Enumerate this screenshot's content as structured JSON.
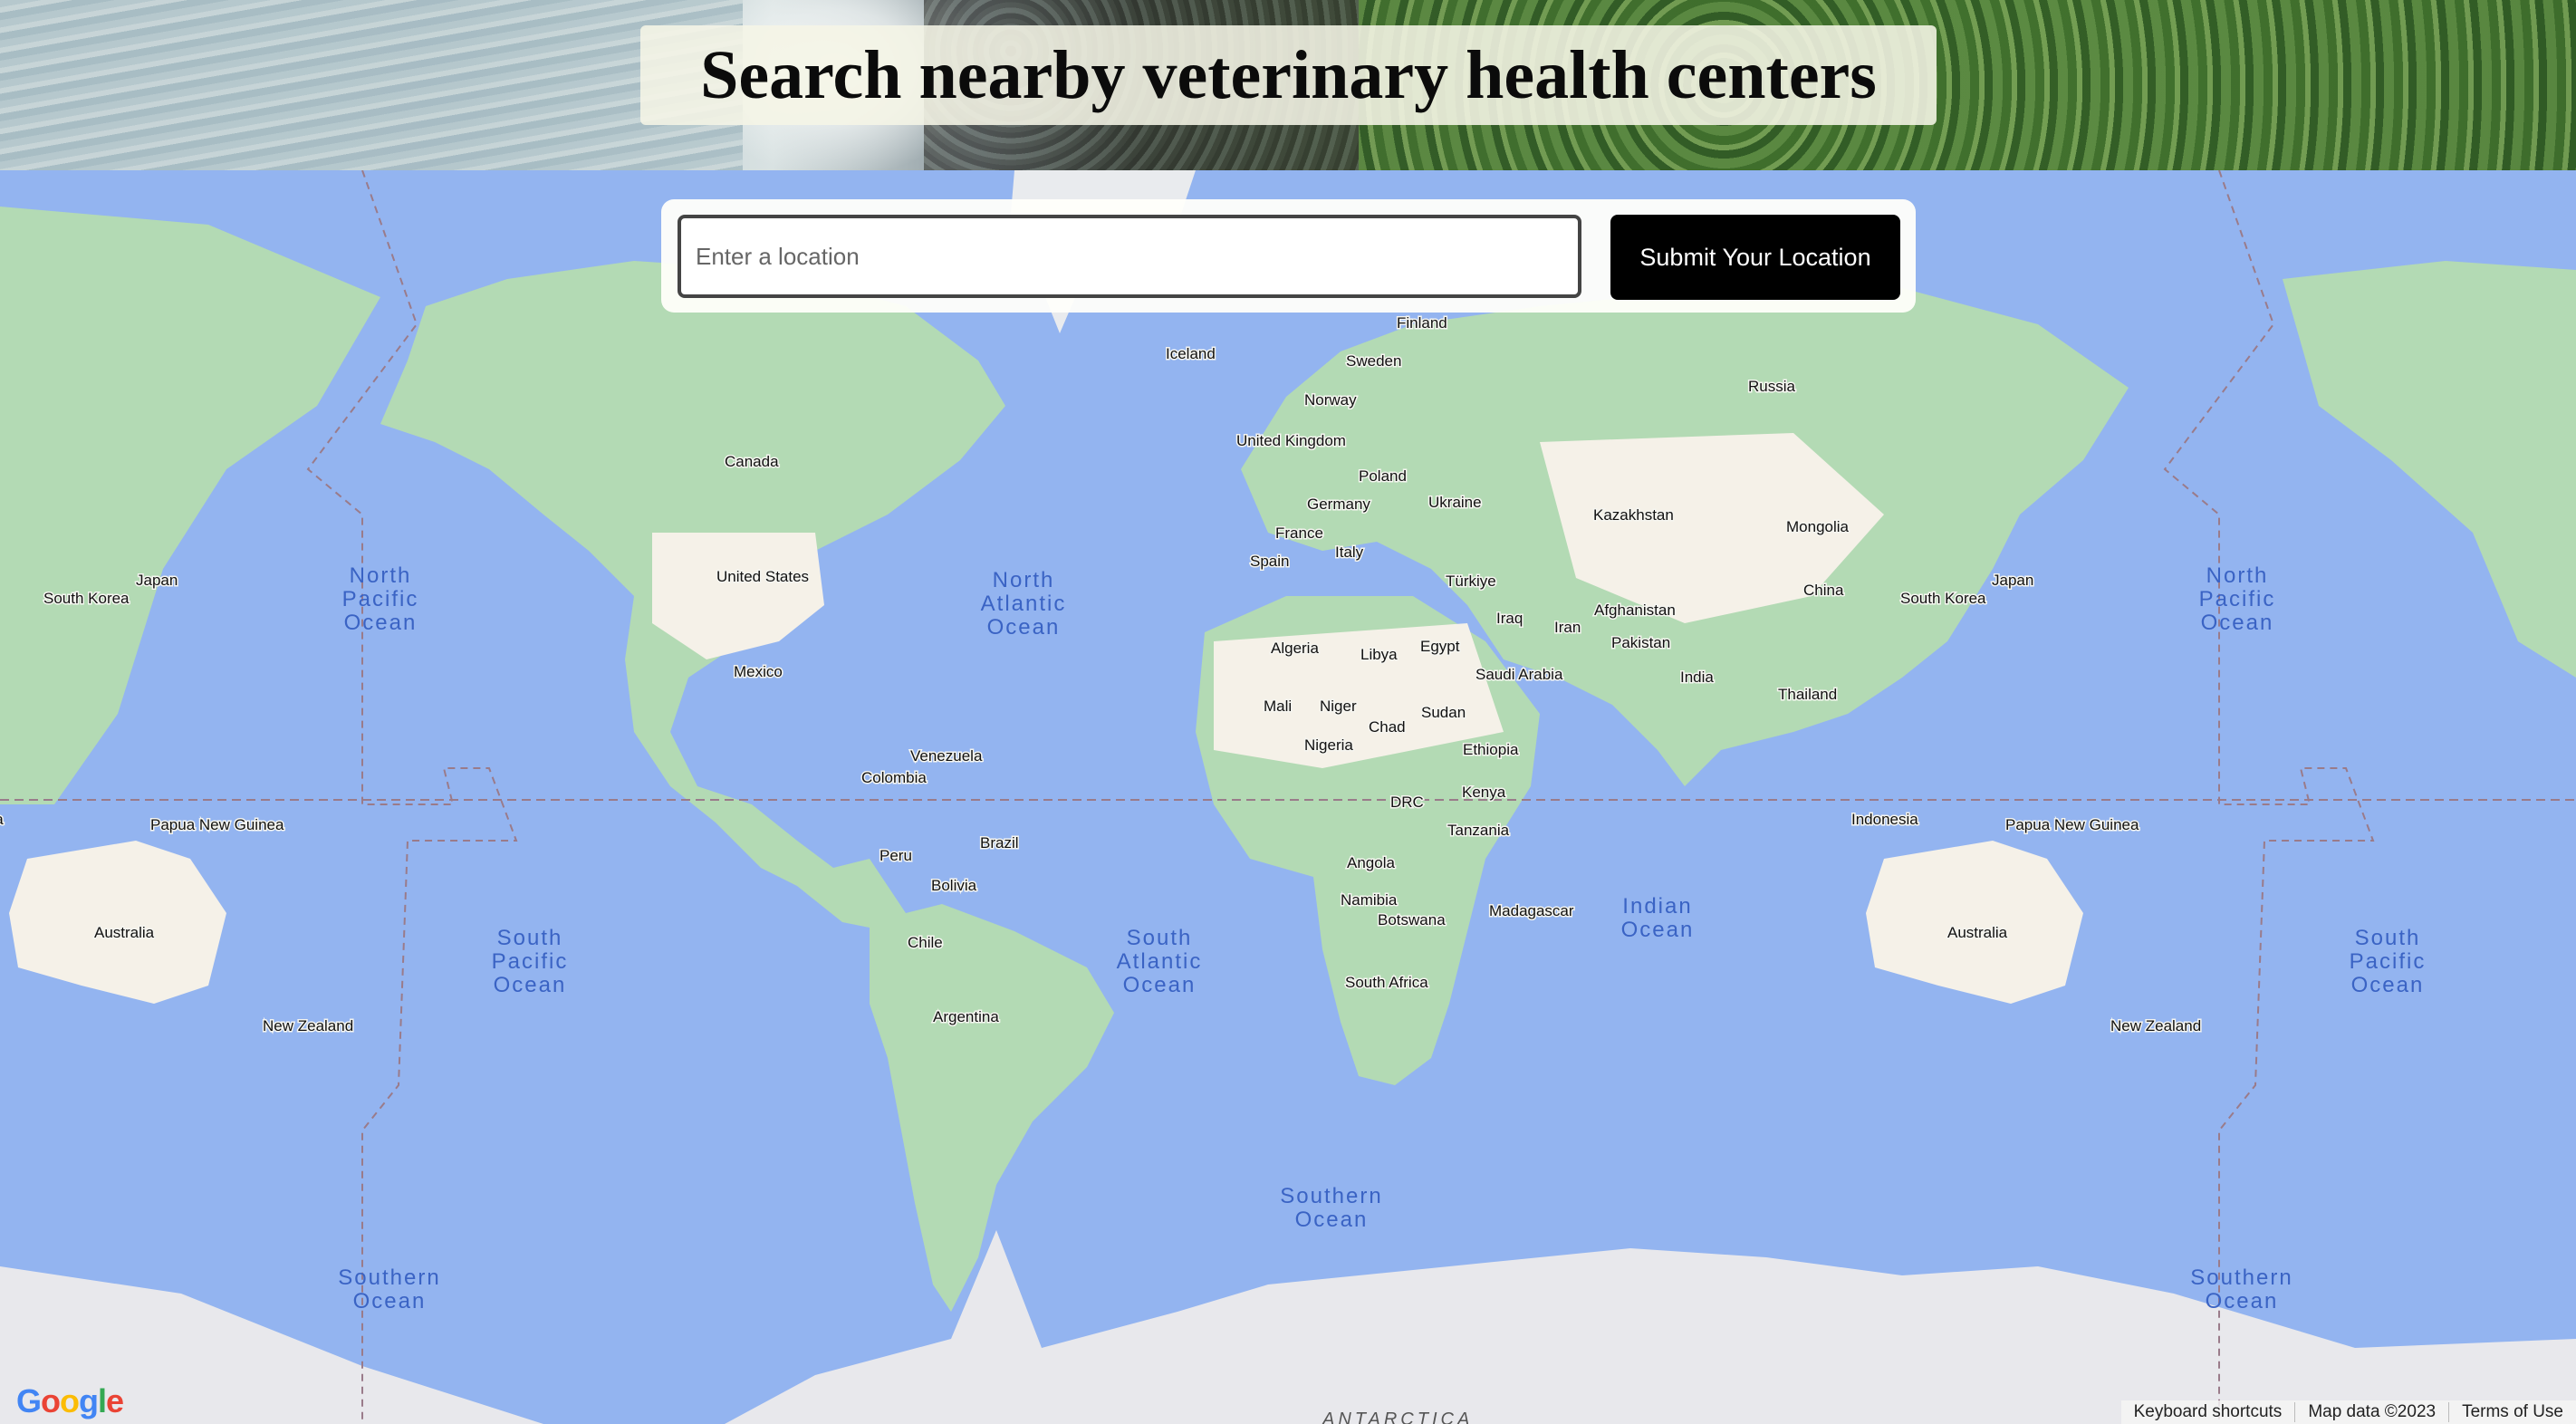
{
  "header": {
    "title": "Search nearby veterinary health centers"
  },
  "search": {
    "placeholder": "Enter a location",
    "value": "",
    "submit_label": "Submit Your Location"
  },
  "map": {
    "countries": [
      "Finland",
      "Iceland",
      "Sweden",
      "Norway",
      "Russia",
      "United Kingdom",
      "Poland",
      "Germany",
      "Ukraine",
      "France",
      "Kazakhstan",
      "Mongolia",
      "Italy",
      "Spain",
      "Türkiye",
      "Japan",
      "South Korea",
      "Canada",
      "United States",
      "Mexico",
      "Iraq",
      "Iran",
      "Afghanistan",
      "Pakistan",
      "China",
      "Algeria",
      "Libya",
      "Egypt",
      "Saudi Arabia",
      "India",
      "Thailand",
      "Mali",
      "Niger",
      "Chad",
      "Sudan",
      "Ethiopia",
      "Nigeria",
      "Venezuela",
      "Colombia",
      "Kenya",
      "DRC",
      "Tanzania",
      "Indonesia",
      "Papua New Guinea",
      "Peru",
      "Brazil",
      "Bolivia",
      "Angola",
      "Namibia",
      "Botswana",
      "Madagascar",
      "Australia",
      "Chile",
      "South Africa",
      "New Zealand",
      "Argentina"
    ],
    "oceans": [
      "North Pacific Ocean",
      "North Atlantic Ocean",
      "South Pacific Ocean",
      "South Atlantic Ocean",
      "Indian Ocean",
      "Southern Ocean"
    ],
    "antarctica_label": "ANTARCTICA"
  },
  "footer": {
    "logo": "Google",
    "keyboard_shortcuts": "Keyboard shortcuts",
    "map_data": "Map data ©2023",
    "terms": "Terms of Use"
  },
  "colors": {
    "water": "#93b4f0",
    "land_green": "#b3dab4",
    "land_sand": "#f5f1e8",
    "ice": "#e8e8ec",
    "button": "#000000"
  }
}
